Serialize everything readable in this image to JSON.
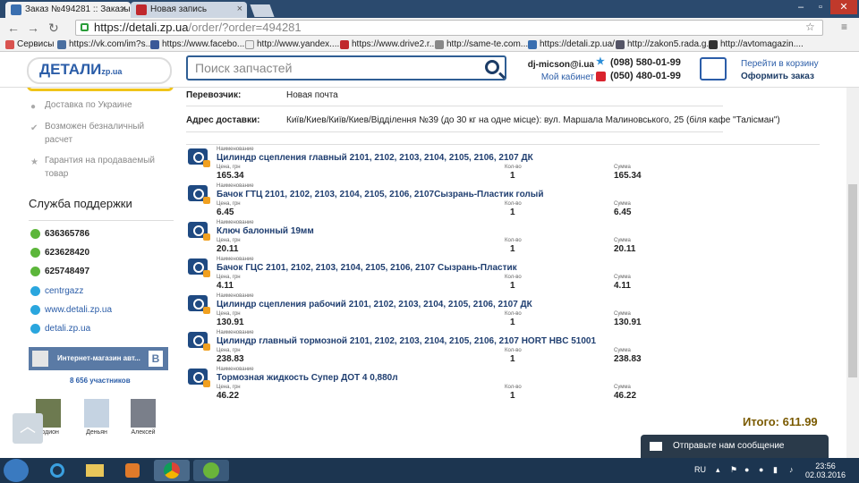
{
  "browser": {
    "tabs": [
      {
        "title": "Заказ №494281 :: Заказы"
      },
      {
        "title": "Новая запись"
      }
    ],
    "url_host": "https://detali.zp.ua",
    "url_path": "/order/?order=494281",
    "bookmarks": [
      "Сервисы",
      "https://vk.com/im?s...",
      "https://www.facebo...",
      "http://www.yandex....",
      "https://www.drive2.r...",
      "http://same-te.com....",
      "https://detali.zp.ua/",
      "http://zakon5.rada.g...",
      "http://avtomagazin...."
    ]
  },
  "header": {
    "logo": "ДЕТАЛИ",
    "logo_suffix": "zp.ua",
    "search_placeholder": "Поиск запчастей",
    "account_email": "dj-micson@i.ua",
    "account_link": "Мой кабинет",
    "phone1": "(098) 580-01-99",
    "phone2": "(050) 480-01-99",
    "cart_link": "Перейти в корзину",
    "cart_order": "Оформить заказ"
  },
  "sidebar": {
    "features": [
      "Доставка по Украине",
      "Возможен безналичный расчет",
      "Гарантия на продаваемый товар"
    ],
    "support_title": "Служба поддержки",
    "numbers": [
      "636365786",
      "623628420",
      "625748497"
    ],
    "links": [
      "centrgazz",
      "www.detali.zp.ua",
      "detali.zp.ua"
    ],
    "vk_title": "Интернет-магазин авт...",
    "vk_members": "8 656 участников",
    "members": [
      "Родион",
      "Деньян",
      "Алексей"
    ]
  },
  "order": {
    "carrier_label": "Перевозчик:",
    "carrier_value": "Новая почта",
    "address_label": "Адрес доставки:",
    "address_value": "Київ/Киев/Київ/Киев/Відділення №39 (до 30 кг на одне місце): вул. Маршала Малиновського, 25 (біля кафе \"Талісман\")",
    "col_name": "Наименование",
    "col_price": "Цена, грн",
    "col_qty": "Кол-во",
    "col_sum": "Сумма",
    "items": [
      {
        "name": "Цилиндр сцепления главный 2101, 2102, 2103, 2104, 2105, 2106, 2107 ДК",
        "price": "165.34",
        "qty": "1",
        "sum": "165.34"
      },
      {
        "name": "Бачок ГТЦ 2101, 2102, 2103, 2104, 2105, 2106, 2107Сызрань-Пластик голый",
        "price": "6.45",
        "qty": "1",
        "sum": "6.45"
      },
      {
        "name": "Ключ балонный 19мм",
        "price": "20.11",
        "qty": "1",
        "sum": "20.11"
      },
      {
        "name": "Бачок ГЦС 2101, 2102, 2103, 2104, 2105, 2106, 2107 Сызрань-Пластик",
        "price": "4.11",
        "qty": "1",
        "sum": "4.11"
      },
      {
        "name": "Цилиндр сцепления рабочий 2101, 2102, 2103, 2104, 2105, 2106, 2107 ДК",
        "price": "130.91",
        "qty": "1",
        "sum": "130.91"
      },
      {
        "name": "Цилиндр главный тормозной 2101, 2102, 2103, 2104, 2105, 2106, 2107 HORT HBC 51001",
        "price": "238.83",
        "qty": "1",
        "sum": "238.83"
      },
      {
        "name": "Тормозная жидкость Супер ДОТ 4 0,880л",
        "price": "46.22",
        "qty": "1",
        "sum": "46.22"
      }
    ],
    "total": "Итого: 611.99"
  },
  "chat": "Отправьте нам сообщение",
  "taskbar": {
    "lang": "RU",
    "time": "23:56",
    "date": "02.03.2016"
  }
}
